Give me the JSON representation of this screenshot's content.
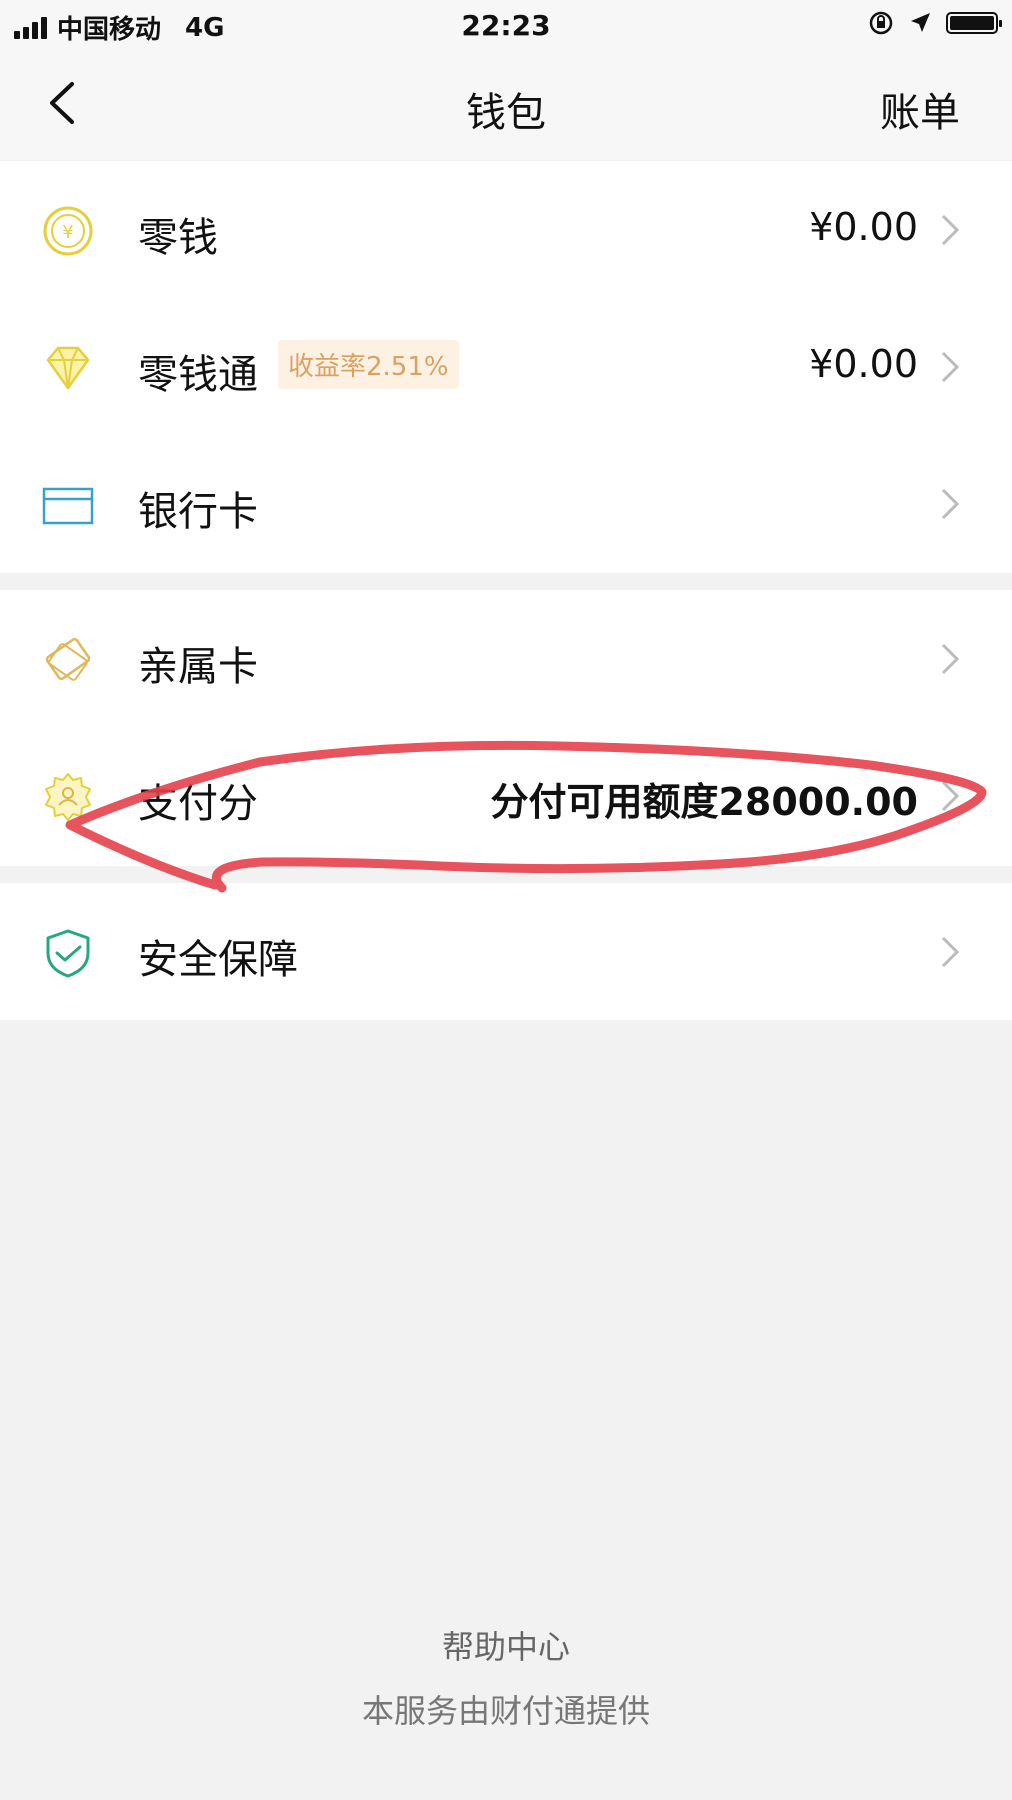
{
  "status_bar": {
    "carrier": "中国移动",
    "network": "4G",
    "time": "22:23"
  },
  "nav": {
    "title": "钱包",
    "right_action": "账单"
  },
  "groups": [
    [
      {
        "label": "零钱",
        "value": "¥0.00",
        "icon": "yuan-coin-icon"
      },
      {
        "label": "零钱通",
        "badge": "收益率2.51%",
        "value": "¥0.00",
        "icon": "diamond-icon"
      },
      {
        "label": "银行卡",
        "icon": "bank-card-icon"
      }
    ],
    [
      {
        "label": "亲属卡",
        "icon": "family-card-icon"
      },
      {
        "label": "支付分",
        "value": "分付可用额度28000.00",
        "icon": "badge-gear-icon"
      }
    ],
    [
      {
        "label": "安全保障",
        "icon": "shield-check-icon"
      }
    ]
  ],
  "footer": {
    "help": "帮助中心",
    "provider": "本服务由财付通提供"
  },
  "colors": {
    "accent_yellow": "#e5cf3a",
    "icon_blue": "#3aa0c8",
    "icon_green": "#26a87a",
    "annotation_red": "#e4414b"
  }
}
